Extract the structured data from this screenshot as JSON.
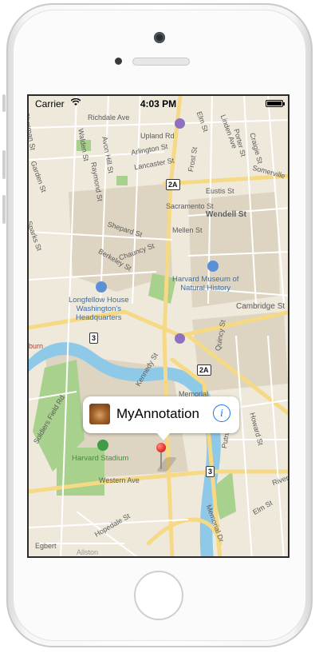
{
  "status_bar": {
    "carrier": "Carrier",
    "time": "4:03 PM"
  },
  "callout": {
    "title": "MyAnnotation",
    "info_glyph": "i",
    "avatar_icon": "monkey-avatar"
  },
  "map": {
    "streets": [
      "Sherman St",
      "Richdale Ave",
      "Upland Rd",
      "Elm St",
      "Linden Ave",
      "Porter St",
      "Craigie St",
      "Somerville",
      "Walden St",
      "Avon Hill St",
      "Arlington St",
      "Lancaster St",
      "Frost St",
      "Garden St",
      "Raymond St",
      "Eustis St",
      "Sacramento St",
      "Wendell St",
      "Sparks St",
      "Shepard St",
      "Mellen St",
      "Berkeley St",
      "Chauncy St",
      "Cambridge St",
      "Quincy St",
      "Kennedy St",
      "Memorial",
      "Soldiers Field Rd",
      "Putnam Ave",
      "Howard St",
      "Western Ave",
      "River",
      "Hopedale St",
      "Allston",
      "Memorial Dr",
      "Elm St",
      "Egbert"
    ],
    "pois": {
      "harvard_museum": [
        "Harvard Museum of",
        "Natural History"
      ],
      "longfellow": [
        "Longfellow House",
        "Washington's",
        "Headquarters"
      ],
      "harvard_stadium": "Harvard Stadium",
      "cut_label": "burn"
    },
    "shields": {
      "route_2a": "2A",
      "route_3": "3"
    }
  },
  "colors": {
    "accent": "#1a73e8",
    "pin": "#e53935",
    "water": "#8ec9e8",
    "park": "#a9d18e"
  }
}
